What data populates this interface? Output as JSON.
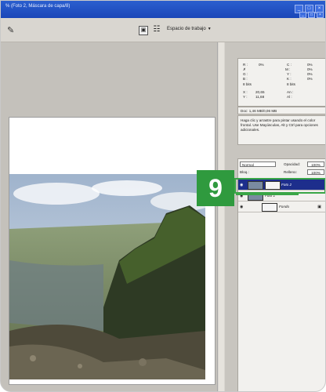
{
  "titlebar": {
    "title": "% (Foto 2, Máscara de capa/8)",
    "controls": [
      "_",
      "□",
      "×"
    ],
    "doc_controls": [
      "_",
      "□",
      "×"
    ]
  },
  "options_bar": {
    "tool_icon": "brush-icon",
    "workspace_label": "Espacio de trabajo",
    "caret": "▼"
  },
  "info_panel": {
    "r_label": "R :",
    "r_value": "0%",
    "c_label": "C :",
    "c_value": "0%",
    "g_label": "G :",
    "m_label": "M :",
    "m_value": "0%",
    "b_label": "B :",
    "y_label": "Y :",
    "y_value": "0%",
    "k_label": "K :",
    "k_value": "0%",
    "bits_left": "8 bits",
    "bits_right": "8 bits",
    "x_label": "X :",
    "x_value": "20,65",
    "y2_label": "Y :",
    "y2_value": "11,68",
    "an_label": "An :",
    "al_label": "Al :"
  },
  "doc_info": "Doc: 1,46 MB/0,06 MB",
  "help_text": "Haga clic y arrastre para pintar usando el color frontal. Use Mayúsculas, Alt y Ctrl para opciones adicionales.",
  "layers": {
    "blend_mode": "Normal",
    "opacity_label": "Opacidad:",
    "opacity_value": "100%",
    "lock_label": "Bloq.:",
    "fill_label": "Relleno:",
    "fill_value": "100%",
    "items": [
      {
        "name": "Foto 2",
        "selected": true
      },
      {
        "name": "Foto 1",
        "selected": false
      },
      {
        "name": "Fondo",
        "selected": false
      }
    ]
  },
  "step": {
    "number": "9"
  },
  "colors": {
    "accent_green": "#2f9a3e",
    "selection_blue": "#1d2e8c",
    "titlebar_blue": "#1a46b8"
  }
}
